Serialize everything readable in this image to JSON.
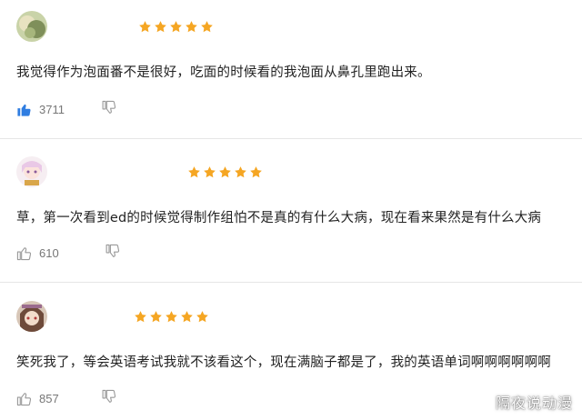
{
  "colors": {
    "star": "#f5a623",
    "like_active": "#2f7de1",
    "like_inactive": "#9a9a9a",
    "text": "#222222",
    "count": "#777777"
  },
  "reviews": [
    {
      "avatar": "avatar-1",
      "rating": 5,
      "text": "我觉得作为泡面番不是很好，吃面的时候看的我泡面从鼻孔里跑出来。",
      "likes": "3711",
      "liked": true
    },
    {
      "avatar": "avatar-2",
      "rating": 5,
      "text": "草，第一次看到ed的时候觉得制作组怕不是真的有什么大病，现在看来果然是有什么大病",
      "likes": "610",
      "liked": false
    },
    {
      "avatar": "avatar-3",
      "rating": 5,
      "text": "笑死我了，等会英语考试我就不该看这个，现在满脑子都是了，我的英语单词啊啊啊啊啊啊",
      "likes": "857",
      "liked": false
    }
  ],
  "watermark": "隔夜说动漫"
}
